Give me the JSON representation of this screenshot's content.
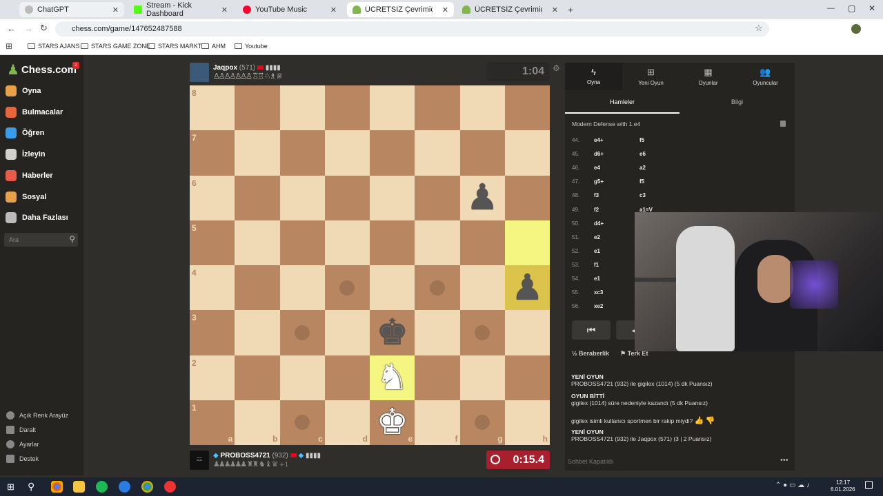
{
  "browser": {
    "tabs": [
      {
        "title": "ChatGPT",
        "color": "#bbbbbb"
      },
      {
        "title": "Stream - Kick Dashboard",
        "color": "#53fc18"
      },
      {
        "title": "YouTube Music",
        "color": "#ff0033"
      },
      {
        "title": "ÜCRETSİZ Çevrimiçi Satranç",
        "color": "#81b64c"
      },
      {
        "title": "ÜCRETSİZ Çevrimiçi Satranç",
        "color": "#81b64c"
      }
    ],
    "url": "chess.com/game/147652487588",
    "bookmarks": [
      "STARS AJANS",
      "STARS GAME ZONE",
      "STARS MARKT",
      "AHM",
      "Youtube"
    ]
  },
  "sidebar": {
    "logo": "Chess.com",
    "badge": "2",
    "items": [
      {
        "label": "Oyna",
        "icon": "pawn-icon",
        "color": "#e8a14b"
      },
      {
        "label": "Bulmacalar",
        "icon": "puzzle-icon",
        "color": "#e8663c"
      },
      {
        "label": "Öğren",
        "icon": "learn-icon",
        "color": "#3b9ce8"
      },
      {
        "label": "İzleyin",
        "icon": "binoculars-icon",
        "color": "#d0d0d0"
      },
      {
        "label": "Haberler",
        "icon": "news-icon",
        "color": "#e85a4b"
      },
      {
        "label": "Sosyal",
        "icon": "social-icon",
        "color": "#e8a14b"
      },
      {
        "label": "Daha Fazlası",
        "icon": "more-icon",
        "color": "#bbbbbb"
      }
    ],
    "search_placeholder": "Ara",
    "bottom": [
      "Açık Renk Arayüz",
      "Daralt",
      "Ayarlar",
      "Destek"
    ]
  },
  "top_player": {
    "name": "Jaqpox",
    "rating": "(571)",
    "clock": "1:04"
  },
  "bottom_player": {
    "name": "PROBOSS4721",
    "rating": "(932)",
    "clock": "0:15.4",
    "material": "+1"
  },
  "board": {
    "ranks": [
      "8",
      "7",
      "6",
      "5",
      "4",
      "3",
      "2",
      "1"
    ],
    "files": [
      "a",
      "b",
      "c",
      "d",
      "e",
      "f",
      "g",
      "h"
    ],
    "pieces": [
      {
        "square": "g6",
        "glyph": "♟",
        "side": "b",
        "name": "black-pawn-g6"
      },
      {
        "square": "h4",
        "glyph": "♟",
        "side": "b",
        "name": "black-pawn-h4"
      },
      {
        "square": "e3",
        "glyph": "♚",
        "side": "b",
        "name": "black-king-e3"
      },
      {
        "square": "e2",
        "glyph": "♞",
        "side": "w",
        "name": "white-knight-e2"
      },
      {
        "square": "e1",
        "glyph": "♚",
        "side": "w",
        "name": "white-king-e1"
      }
    ],
    "highlights": [
      "h5",
      "h4",
      "e2"
    ],
    "hints": [
      "d4",
      "f4",
      "c3",
      "g3",
      "c1",
      "g1"
    ]
  },
  "panel": {
    "tabs": [
      "Oyna",
      "Yeni Oyun",
      "Oyunlar",
      "Oyuncular"
    ],
    "subtabs": [
      "Hamleler",
      "Bilgi"
    ],
    "opening": "Modern Defense with 1.e4",
    "moves": [
      {
        "n": "44.",
        "w": "e4+",
        "b": "f5"
      },
      {
        "n": "45.",
        "w": "d6+",
        "b": "e6"
      },
      {
        "n": "46.",
        "w": "e4",
        "b": "a2"
      },
      {
        "n": "47.",
        "w": "g5+",
        "b": "f5"
      },
      {
        "n": "48.",
        "w": "f3",
        "b": "c3"
      },
      {
        "n": "49.",
        "w": "f2",
        "b": "a1=V"
      },
      {
        "n": "50.",
        "w": "d4+",
        "b": ""
      },
      {
        "n": "51.",
        "w": "e2",
        "b": ""
      },
      {
        "n": "52.",
        "w": "e1",
        "b": ""
      },
      {
        "n": "53.",
        "w": "f1",
        "b": ""
      },
      {
        "n": "54.",
        "w": "e1",
        "b": ""
      },
      {
        "n": "55.",
        "w": "xc3",
        "b": ""
      },
      {
        "n": "56.",
        "w": "xe2",
        "b": ""
      }
    ],
    "draw": "Beraberlik",
    "resign": "Terk Et",
    "chat": [
      {
        "head": "YENİ OYUN",
        "text": "PROBOSS4721 (932) ile gigilex (1014) (5 dk Puansız)"
      },
      {
        "head": "OYUN BİTTİ",
        "text": "gigilex (1014) süre nedeniyle kazandı (5 dk Puansız)"
      },
      {
        "head": "",
        "text": "gigilex isimli kullanıcı sportmen bir rakip miydi?"
      },
      {
        "head": "YENİ OYUN",
        "text": "PROBOSS4721 (932) ile Jaqpox (571) (3 | 2 Puansız)"
      }
    ],
    "chat_closed": "Sohbet Kapatıldı"
  },
  "taskbar": {
    "time": "12:17",
    "date": "6.01.2026"
  }
}
